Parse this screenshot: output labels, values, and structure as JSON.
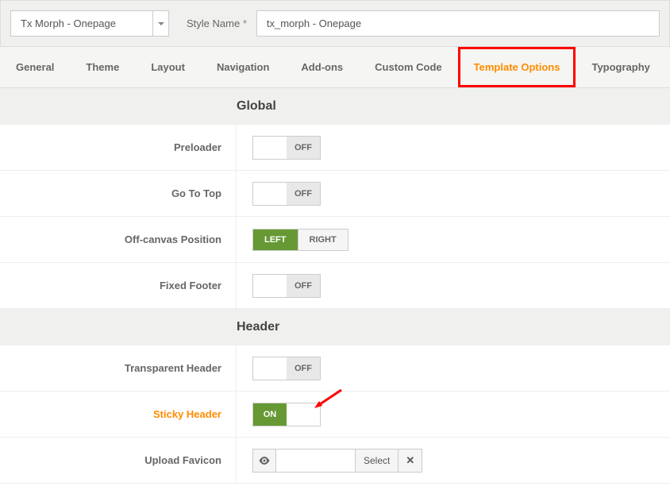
{
  "topbar": {
    "template_dropdown": "Tx Morph - Onepage",
    "style_name_label": "Style Name",
    "style_name_value": "tx_morph - Onepage"
  },
  "tabs": [
    {
      "label": "General",
      "active": false
    },
    {
      "label": "Theme",
      "active": false
    },
    {
      "label": "Layout",
      "active": false
    },
    {
      "label": "Navigation",
      "active": false
    },
    {
      "label": "Add-ons",
      "active": false
    },
    {
      "label": "Custom Code",
      "active": false
    },
    {
      "label": "Template Options",
      "active": true,
      "highlighted": true
    },
    {
      "label": "Typography",
      "active": false
    }
  ],
  "sections": {
    "global": {
      "title": "Global",
      "fields": {
        "preloader": {
          "label": "Preloader",
          "state": "off",
          "off_text": "OFF"
        },
        "go_to_top": {
          "label": "Go To Top",
          "state": "off",
          "off_text": "OFF"
        },
        "off_canvas": {
          "label": "Off-canvas Position",
          "left": "LEFT",
          "right": "RIGHT",
          "active": "left"
        },
        "fixed_footer": {
          "label": "Fixed Footer",
          "state": "off",
          "off_text": "OFF"
        }
      }
    },
    "header": {
      "title": "Header",
      "fields": {
        "transparent": {
          "label": "Transparent Header",
          "state": "off",
          "off_text": "OFF"
        },
        "sticky": {
          "label": "Sticky Header",
          "state": "on",
          "on_text": "ON"
        },
        "favicon": {
          "label": "Upload Favicon",
          "select_text": "Select"
        }
      }
    }
  }
}
